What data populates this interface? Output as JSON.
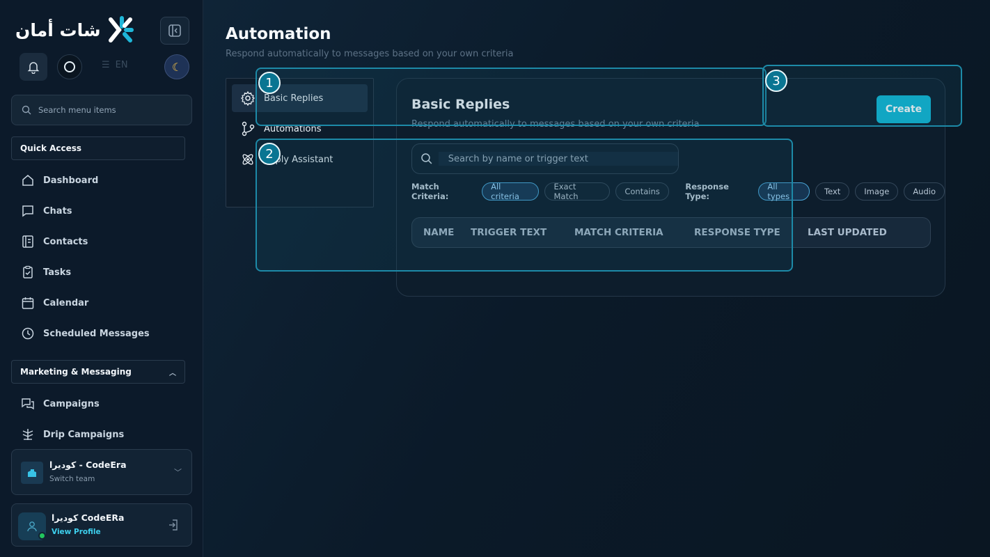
{
  "app": {
    "logo_text": "شات أمان",
    "lang_label": "EN"
  },
  "sidebar": {
    "search_placeholder": "Search menu items",
    "quick_access_label": "Quick Access",
    "quick_items": [
      {
        "label": "Dashboard",
        "icon": "home-icon"
      },
      {
        "label": "Chats",
        "icon": "chat-icon"
      },
      {
        "label": "Contacts",
        "icon": "contacts-icon"
      },
      {
        "label": "Tasks",
        "icon": "clipboard-check-icon"
      },
      {
        "label": "Calendar",
        "icon": "calendar-icon"
      },
      {
        "label": "Scheduled Messages",
        "icon": "clock-icon"
      }
    ],
    "marketing_label": "Marketing & Messaging",
    "marketing_items": [
      {
        "label": "Campaigns",
        "icon": "campaign-icon"
      },
      {
        "label": "Drip Campaigns",
        "icon": "drip-icon"
      }
    ],
    "team": {
      "name": "كوديرا - CodeEra",
      "sub": "Switch team"
    },
    "profile": {
      "name": "كوديرا CodeERa",
      "link": "View Profile"
    }
  },
  "page": {
    "title": "Automation",
    "subtitle": "Respond automatically to messages based on your own criteria"
  },
  "subnav": [
    {
      "label": "Basic Replies",
      "icon": "gear-icon",
      "active": true
    },
    {
      "label": "Automations",
      "icon": "flow-icon",
      "active": false
    },
    {
      "label": "Reply Assistant",
      "icon": "assistant-icon",
      "active": false
    }
  ],
  "card": {
    "title": "Basic Replies",
    "subtitle": "Respond automatically to messages based on your own criteria",
    "create_label": "Create",
    "search_placeholder": "Search by name or trigger text",
    "match_label": "Match Criteria:",
    "match_options": [
      "All criteria",
      "Exact Match",
      "Contains"
    ],
    "match_selected": "All criteria",
    "response_label": "Response Type:",
    "response_options": [
      "All types",
      "Text",
      "Image",
      "Audio"
    ],
    "response_selected": "All types",
    "columns": [
      "NAME",
      "TRIGGER TEXT",
      "MATCH CRITERIA",
      "RESPONSE TYPE",
      "LAST UPDATED"
    ]
  },
  "tour": {
    "steps": [
      "1",
      "2",
      "3"
    ]
  },
  "colors": {
    "accent": "#10b8d6",
    "highlight": "#1d8aa8"
  }
}
